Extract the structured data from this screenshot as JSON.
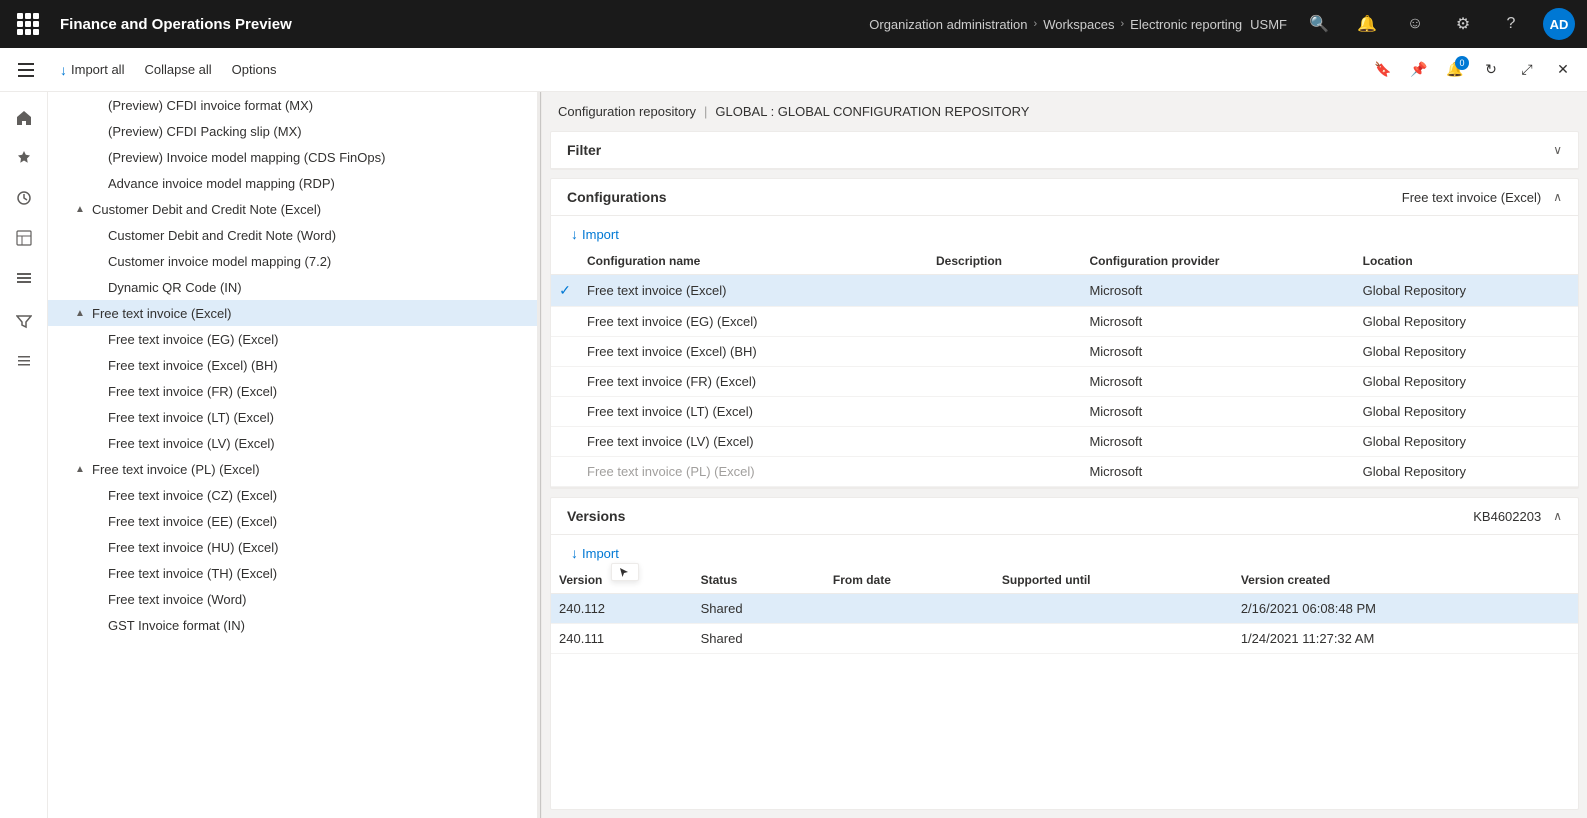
{
  "topbar": {
    "app_title": "Finance and Operations Preview",
    "breadcrumb": [
      "Organization administration",
      "Workspaces",
      "Electronic reporting"
    ],
    "company": "USMF",
    "avatar_initials": "AD"
  },
  "toolbar": {
    "import_all": "Import all",
    "collapse_all": "Collapse all",
    "options": "Options"
  },
  "right_panel": {
    "breadcrumb_left": "Configuration repository",
    "breadcrumb_right": "GLOBAL : GLOBAL CONFIGURATION REPOSITORY"
  },
  "filter": {
    "title": "Filter"
  },
  "configurations": {
    "title": "Configurations",
    "selected_filter": "Free text invoice (Excel)",
    "import_label": "Import",
    "columns": [
      "",
      "Configuration name",
      "Description",
      "Configuration provider",
      "Location"
    ],
    "rows": [
      {
        "name": "Free text invoice (Excel)",
        "description": "",
        "provider": "Microsoft",
        "location": "Global Repository",
        "selected": true
      },
      {
        "name": "Free text invoice (EG) (Excel)",
        "description": "",
        "provider": "Microsoft",
        "location": "Global Repository",
        "selected": false
      },
      {
        "name": "Free text invoice (Excel) (BH)",
        "description": "",
        "provider": "Microsoft",
        "location": "Global Repository",
        "selected": false
      },
      {
        "name": "Free text invoice (FR) (Excel)",
        "description": "",
        "provider": "Microsoft",
        "location": "Global Repository",
        "selected": false
      },
      {
        "name": "Free text invoice (LT) (Excel)",
        "description": "",
        "provider": "Microsoft",
        "location": "Global Repository",
        "selected": false
      },
      {
        "name": "Free text invoice (LV) (Excel)",
        "description": "",
        "provider": "Microsoft",
        "location": "Global Repository",
        "selected": false
      },
      {
        "name": "Free text invoice (PL) (Excel)",
        "description": "",
        "provider": "Microsoft",
        "location": "Global Repository",
        "selected": false,
        "partial": true
      }
    ]
  },
  "versions": {
    "title": "Versions",
    "tag": "KB4602203",
    "import_label": "Import",
    "columns": [
      "Version",
      "Status",
      "From date",
      "Supported until",
      "Version created"
    ],
    "rows": [
      {
        "version": "240.112",
        "status": "Shared",
        "from_date": "",
        "supported_until": "",
        "version_created": "2/16/2021 06:08:48 PM",
        "selected": true
      },
      {
        "version": "240.111",
        "status": "Shared",
        "from_date": "",
        "supported_until": "",
        "version_created": "1/24/2021 11:27:32 AM",
        "selected": false
      }
    ]
  },
  "tree": {
    "items": [
      {
        "label": "(Preview) CFDI invoice format (MX)",
        "indent": 2,
        "toggle": "",
        "selected": false
      },
      {
        "label": "(Preview) CFDI Packing slip (MX)",
        "indent": 2,
        "toggle": "",
        "selected": false
      },
      {
        "label": "(Preview) Invoice model mapping (CDS FinOps)",
        "indent": 2,
        "toggle": "",
        "selected": false
      },
      {
        "label": "Advance invoice model mapping (RDP)",
        "indent": 2,
        "toggle": "",
        "selected": false
      },
      {
        "label": "Customer Debit and Credit Note (Excel)",
        "indent": 1,
        "toggle": "▲",
        "selected": false
      },
      {
        "label": "Customer Debit and Credit Note (Word)",
        "indent": 2,
        "toggle": "",
        "selected": false
      },
      {
        "label": "Customer invoice model mapping (7.2)",
        "indent": 2,
        "toggle": "",
        "selected": false
      },
      {
        "label": "Dynamic QR Code (IN)",
        "indent": 2,
        "toggle": "",
        "selected": false
      },
      {
        "label": "Free text invoice (Excel)",
        "indent": 1,
        "toggle": "▲",
        "selected": true
      },
      {
        "label": "Free text invoice (EG) (Excel)",
        "indent": 2,
        "toggle": "",
        "selected": false
      },
      {
        "label": "Free text invoice (Excel) (BH)",
        "indent": 2,
        "toggle": "",
        "selected": false
      },
      {
        "label": "Free text invoice (FR) (Excel)",
        "indent": 2,
        "toggle": "",
        "selected": false
      },
      {
        "label": "Free text invoice (LT) (Excel)",
        "indent": 2,
        "toggle": "",
        "selected": false
      },
      {
        "label": "Free text invoice (LV) (Excel)",
        "indent": 2,
        "toggle": "",
        "selected": false
      },
      {
        "label": "Free text invoice (PL) (Excel)",
        "indent": 1,
        "toggle": "▲",
        "selected": false
      },
      {
        "label": "Free text invoice (CZ) (Excel)",
        "indent": 2,
        "toggle": "",
        "selected": false
      },
      {
        "label": "Free text invoice (EE) (Excel)",
        "indent": 2,
        "toggle": "",
        "selected": false
      },
      {
        "label": "Free text invoice (HU) (Excel)",
        "indent": 2,
        "toggle": "",
        "selected": false
      },
      {
        "label": "Free text invoice (TH) (Excel)",
        "indent": 2,
        "toggle": "",
        "selected": false
      },
      {
        "label": "Free text invoice (Word)",
        "indent": 2,
        "toggle": "",
        "selected": false
      },
      {
        "label": "GST Invoice format (IN)",
        "indent": 2,
        "toggle": "",
        "selected": false
      }
    ]
  },
  "icons": {
    "grid": "⊞",
    "hamburger": "☰",
    "home": "⌂",
    "star": "☆",
    "clock": "◷",
    "table": "▦",
    "list": "☰",
    "filter": "⊟",
    "search": "🔍",
    "settings": "⚙",
    "question": "?",
    "notification": "🔔",
    "smiley": "☺",
    "refresh": "↻",
    "maximize": "⤢",
    "close": "✕",
    "bookmark": "🔖",
    "pin": "📌",
    "import_down": "↓",
    "chevron_down": "∨",
    "chevron_up": "∧",
    "check": "✓"
  }
}
